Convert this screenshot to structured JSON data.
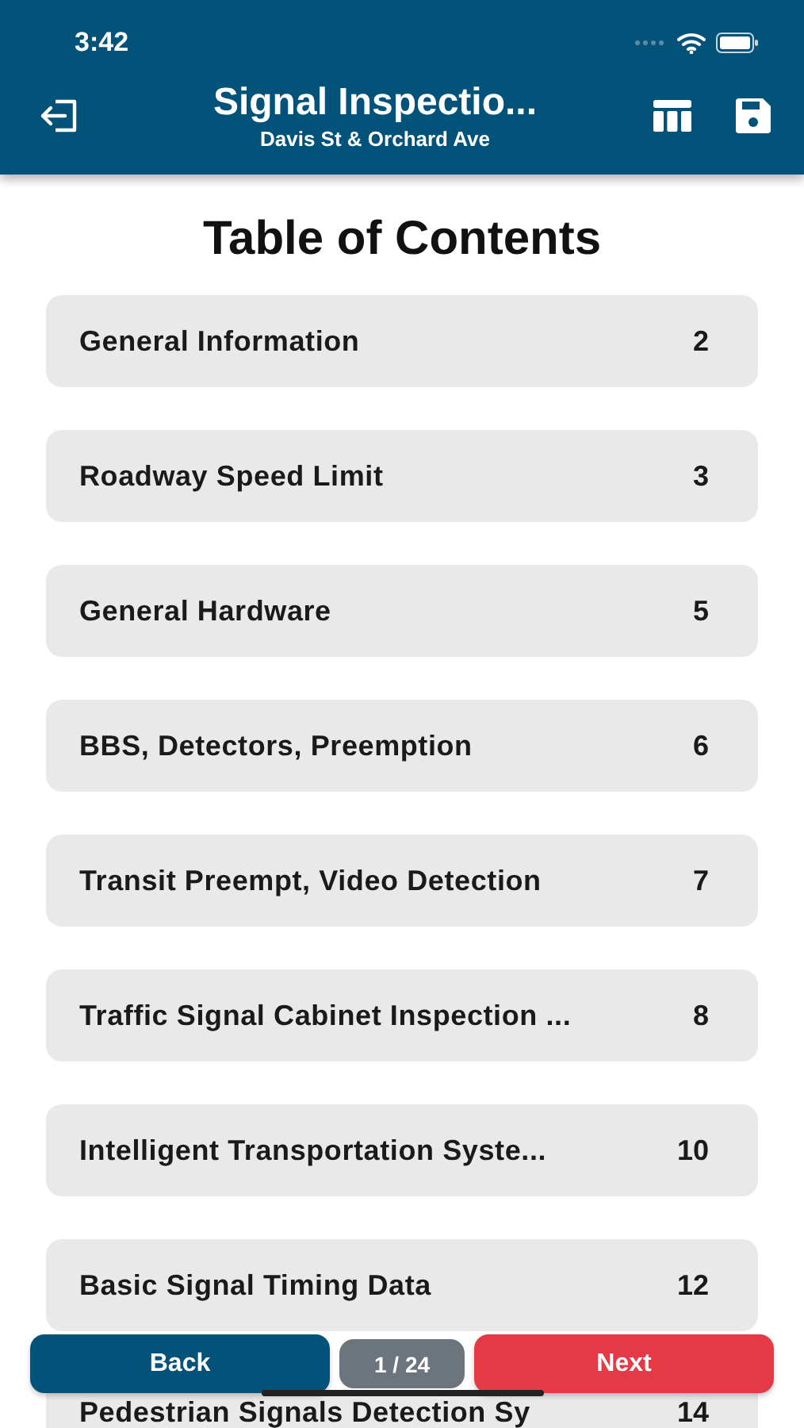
{
  "status_bar": {
    "time": "3:42"
  },
  "header": {
    "title": "Signal Inspectio...",
    "subtitle": "Davis St & Orchard Ave"
  },
  "page_title": "Table of Contents",
  "contents": [
    {
      "label": "General Information",
      "page": "2"
    },
    {
      "label": "Roadway Speed Limit",
      "page": "3"
    },
    {
      "label": "General Hardware",
      "page": "5"
    },
    {
      "label": "BBS, Detectors, Preemption",
      "page": "6"
    },
    {
      "label": "Transit Preempt, Video Detection",
      "page": "7"
    },
    {
      "label": "Traffic Signal Cabinet Inspection ...",
      "page": "8"
    },
    {
      "label": "Intelligent Transportation Syste...",
      "page": "10"
    },
    {
      "label": "Basic Signal Timing Data",
      "page": "12"
    },
    {
      "label": "Pedestrian Signals Detection Sy",
      "page": "14"
    }
  ],
  "footer": {
    "back": "Back",
    "pager": "1 / 24",
    "next": "Next"
  }
}
